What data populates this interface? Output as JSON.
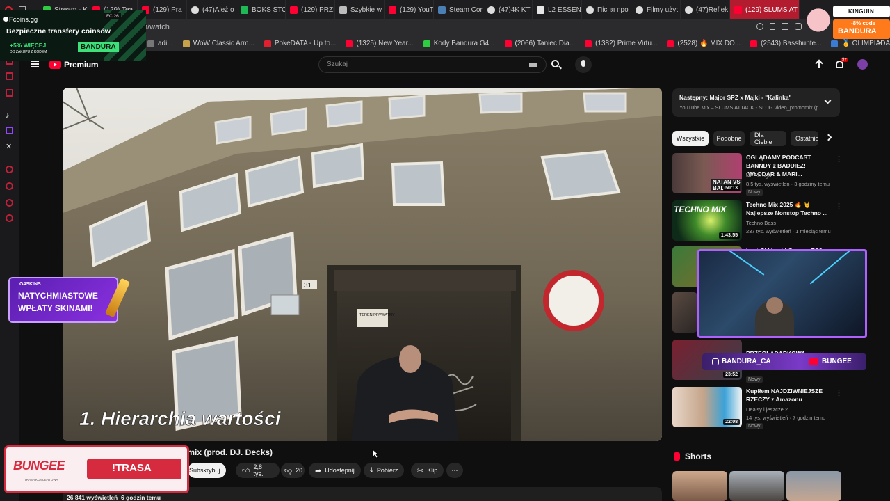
{
  "tabs": [
    {
      "label": "Stream - K",
      "icon": "green"
    },
    {
      "label": "(129) Tea",
      "icon": "yt"
    },
    {
      "label": "(129) Pra",
      "icon": "yt"
    },
    {
      "label": "(47)Ależ o",
      "icon": "tiktok"
    },
    {
      "label": "BOKS STO",
      "icon": "spotify"
    },
    {
      "label": "(129) PRZE",
      "icon": "yt"
    },
    {
      "label": "Szybkie w",
      "icon": "grid"
    },
    {
      "label": "(129) YouT",
      "icon": "yt"
    },
    {
      "label": "Steam Con",
      "icon": "steam"
    },
    {
      "label": "(47)4K KT",
      "icon": "tiktok"
    },
    {
      "label": "L2 ESSEN",
      "icon": "doc"
    },
    {
      "label": "Пісня про",
      "icon": "tiktok"
    },
    {
      "label": "Filmy użyt",
      "icon": "tiktok"
    },
    {
      "label": "(47)Reflek",
      "icon": "tiktok"
    },
    {
      "label": "(129) SLUMS AT",
      "icon": "yt",
      "active": true
    }
  ],
  "url": "n/watch",
  "bookmarks": [
    {
      "label": "adi...",
      "icon": "dark"
    },
    {
      "label": "WoW Classic Arm...",
      "icon": "wow"
    },
    {
      "label": "PokeDATA - Up to...",
      "icon": "red"
    },
    {
      "label": "(1325) New Year...",
      "icon": "yt"
    },
    {
      "label": "Kody Bandura G4...",
      "icon": "green"
    },
    {
      "label": "(2066) Taniec Dia...",
      "icon": "yt"
    },
    {
      "label": "(1382) Prime Virtu...",
      "icon": "yt"
    },
    {
      "label": "(2528) 🔥 MIX DO...",
      "icon": "yt"
    },
    {
      "label": "(2543) Basshunte...",
      "icon": "yt"
    },
    {
      "label": "🥇 OLIMPIADA ST...",
      "icon": "blue"
    }
  ],
  "fcoins": {
    "brand": "Fcoins.gg",
    "headline": "Bezpieczne transfery coinsów",
    "bonus": "+5% WIĘCEJ",
    "bonus_sub": "DO ZAKUPU Z KODEM",
    "code": "BANDURA"
  },
  "overlay_small": {
    "label": "FC 26"
  },
  "kinguin": {
    "brand": "KINGUIN",
    "discount": "-8% code",
    "code": "BANDURA"
  },
  "youtube": {
    "logo_text": "Premium",
    "search_placeholder": "Szukaj",
    "notif_count": "9+"
  },
  "video": {
    "caption": "1. Hierarchia wartości",
    "sign_number": "31",
    "sign_private": "TEREN PRYWATNY",
    "title_visible": "omix (prod. DJ. Decks)",
    "views": "26 841 wyświetleń  6 godzin temu"
  },
  "actions": {
    "subscribe": "Subskrybuj",
    "likes": "2,8 tys.",
    "dislikes": "20",
    "share": "Udostępnij",
    "download": "Pobierz",
    "clip": "Klip",
    "more": "⋯"
  },
  "upnext": {
    "label": "Następny: Major SPZ x Majki - \"Kalinka\"",
    "sub": "YouTube Mix – SLUMS ATTACK - SLUG video_promomix (pr..."
  },
  "chips": [
    "Wszystkie",
    "Podobne",
    "Dla Ciebie",
    "Ostatnio"
  ],
  "recommendations": [
    {
      "title": "OGLĄDAMY PODCAST BANNDY z BADDIEZ! (WŁODAR & MARI...",
      "channel": "NEEXcsgo",
      "meta": "8,5 tys. wyświetleń · 3 godziny temu",
      "badge": "Nowy",
      "duration": "50:13",
      "thumb_text": "NATAN VS BAD"
    },
    {
      "title": "Techno Mix 2025 🔥 🤘 Najlepsze Nonstop Techno ...",
      "channel": "Techno Bass",
      "meta": "237 tys. wyświetleń · 1 miesiąc temu",
      "badge": "",
      "duration": "1:43:55",
      "thumb_text": "TECHNO MIX"
    },
    {
      "title": "Lost CM back! Can my PS2 ...",
      "channel": "",
      "meta": "",
      "badge": "",
      "duration": "",
      "thumb_text": ""
    },
    {
      "title": "",
      "channel": "",
      "meta": "",
      "badge": "",
      "duration": "",
      "thumb_text": ""
    },
    {
      "title": "PRZEGLĄDARKOWA",
      "channel": "",
      "meta": "",
      "badge": "Nowy",
      "duration": "23:52",
      "thumb_text": ""
    },
    {
      "title": "Kupiłem NAJDZIWNIEJSZE RZECZY z Amazonu",
      "channel": "Dealsy i jeszcze 2",
      "meta": "14 tys. wyświetleń · 7 godzin temu",
      "badge": "Nowy",
      "duration": "22:08",
      "thumb_text": ""
    }
  ],
  "shorts_label": "Shorts",
  "g4skins": {
    "brand": "G4SKINS",
    "line1": "NATYCHMIASTOWE",
    "line2": "WPŁATY SKINAMI!"
  },
  "bungee_banner": {
    "logo": "BUNGEE",
    "sub": "TRASA KONCERTOWA",
    "cta": "!TRASA"
  },
  "webcam": {
    "handle1": "BANDURA_CA",
    "handle2": "BUNGEE"
  }
}
